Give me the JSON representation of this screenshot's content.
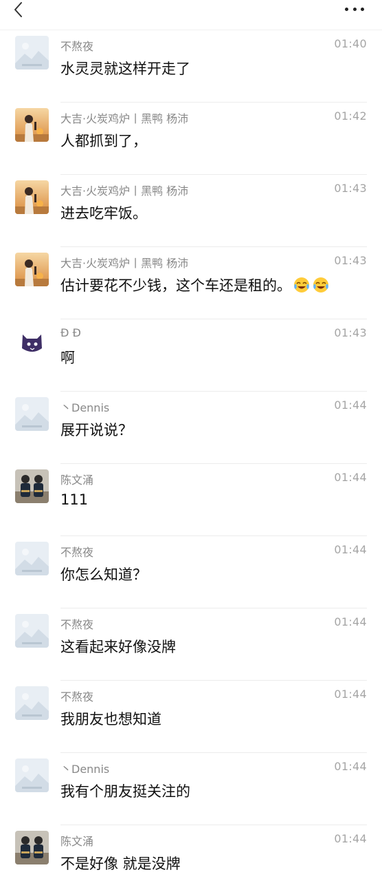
{
  "header": {
    "back_icon": "chevron-left-icon",
    "more_icon": "more-dots-icon"
  },
  "messages": [
    {
      "avatar": "landscape-placeholder",
      "name": "不熬夜",
      "time": "01:40",
      "text": "水灵灵就这样开走了",
      "emoji_count": 0
    },
    {
      "avatar": "sunset-person",
      "name": "大吉·火炭鸡炉丨黑鸭 杨沛",
      "time": "01:42",
      "text": "人都抓到了，",
      "emoji_count": 0
    },
    {
      "avatar": "sunset-person",
      "name": "大吉·火炭鸡炉丨黑鸭 杨沛",
      "time": "01:43",
      "text": "进去吃牢饭。",
      "emoji_count": 0
    },
    {
      "avatar": "sunset-person",
      "name": "大吉·火炭鸡炉丨黑鸭 杨沛",
      "time": "01:43",
      "text": "估计要花不少钱，这个车还是租的。",
      "emoji_count": 2,
      "emoji": "laughing-crying-emoji"
    },
    {
      "avatar": "purple-cat",
      "name": "Đ Đ",
      "time": "01:43",
      "text": "啊",
      "emoji_count": 0
    },
    {
      "avatar": "landscape-placeholder",
      "name": "丶Dennis",
      "time": "01:44",
      "text": "展开说说？",
      "emoji_count": 0
    },
    {
      "avatar": "two-kids",
      "name": "陈文涌",
      "time": "01:44",
      "text": "111",
      "emoji_count": 0
    },
    {
      "avatar": "landscape-placeholder",
      "name": "不熬夜",
      "time": "01:44",
      "text": "你怎么知道？",
      "emoji_count": 0
    },
    {
      "avatar": "landscape-placeholder",
      "name": "不熬夜",
      "time": "01:44",
      "text": "这看起来好像没牌",
      "emoji_count": 0
    },
    {
      "avatar": "landscape-placeholder",
      "name": "不熬夜",
      "time": "01:44",
      "text": "我朋友也想知道",
      "emoji_count": 0
    },
    {
      "avatar": "landscape-placeholder",
      "name": "丶Dennis",
      "time": "01:44",
      "text": "我有个朋友挺关注的",
      "emoji_count": 0
    },
    {
      "avatar": "two-kids",
      "name": "陈文涌",
      "time": "01:44",
      "text": "不是好像 就是没牌",
      "emoji_count": 0
    }
  ]
}
